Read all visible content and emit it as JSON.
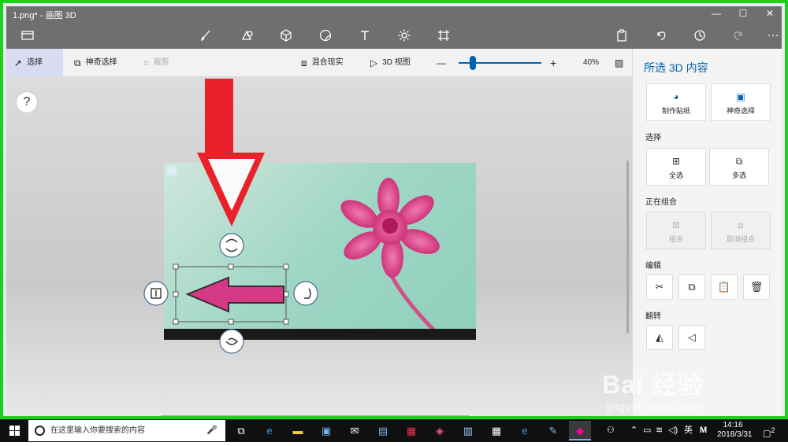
{
  "window": {
    "title": "1.png* - 画图 3D"
  },
  "window_controls": {
    "minimize": "—",
    "maximize": "☐",
    "close": "✕"
  },
  "toolbar": {
    "icons": [
      "menu-icon",
      "brush-icon",
      "2d-shapes-icon",
      "3d-shapes-icon",
      "stickers-icon",
      "text-icon",
      "effects-icon",
      "canvas-icon",
      "paste-icon",
      "undo-icon",
      "history-icon",
      "redo-icon",
      "more-icon"
    ],
    "more_label": "···"
  },
  "subbar": {
    "select": "选择",
    "magic_select": "神奇选择",
    "crop": "裁剪",
    "mixed_reality": "混合现实",
    "view_3d": "3D 视图",
    "zoom_minus": "—",
    "zoom_plus": "+",
    "zoom_value": "40%",
    "zoom_level": 0.4
  },
  "canvas": {
    "help": "?"
  },
  "panel": {
    "title": "所选 3D 内容",
    "make_sticker": "制作贴纸",
    "magic_select": "神奇选择",
    "section_select": "选择",
    "select_all": "全选",
    "multi_select": "多选",
    "section_grouping": "正在组合",
    "group": "组合",
    "ungroup": "取消组合",
    "section_edit": "编辑",
    "section_flip": "翻转"
  },
  "taskbar": {
    "search_placeholder": "在这里输入你要搜索的内容",
    "ime": "英",
    "time": "14:16",
    "date": "2018/3/31",
    "notif_count": "2"
  },
  "watermark": {
    "brand": "Bai 经验",
    "url": "jingyan.baidu.com"
  },
  "colors": {
    "accent": "#0063b1",
    "frame": "#19d119",
    "arrow": "#e8212a",
    "flower": "#d63a86"
  }
}
